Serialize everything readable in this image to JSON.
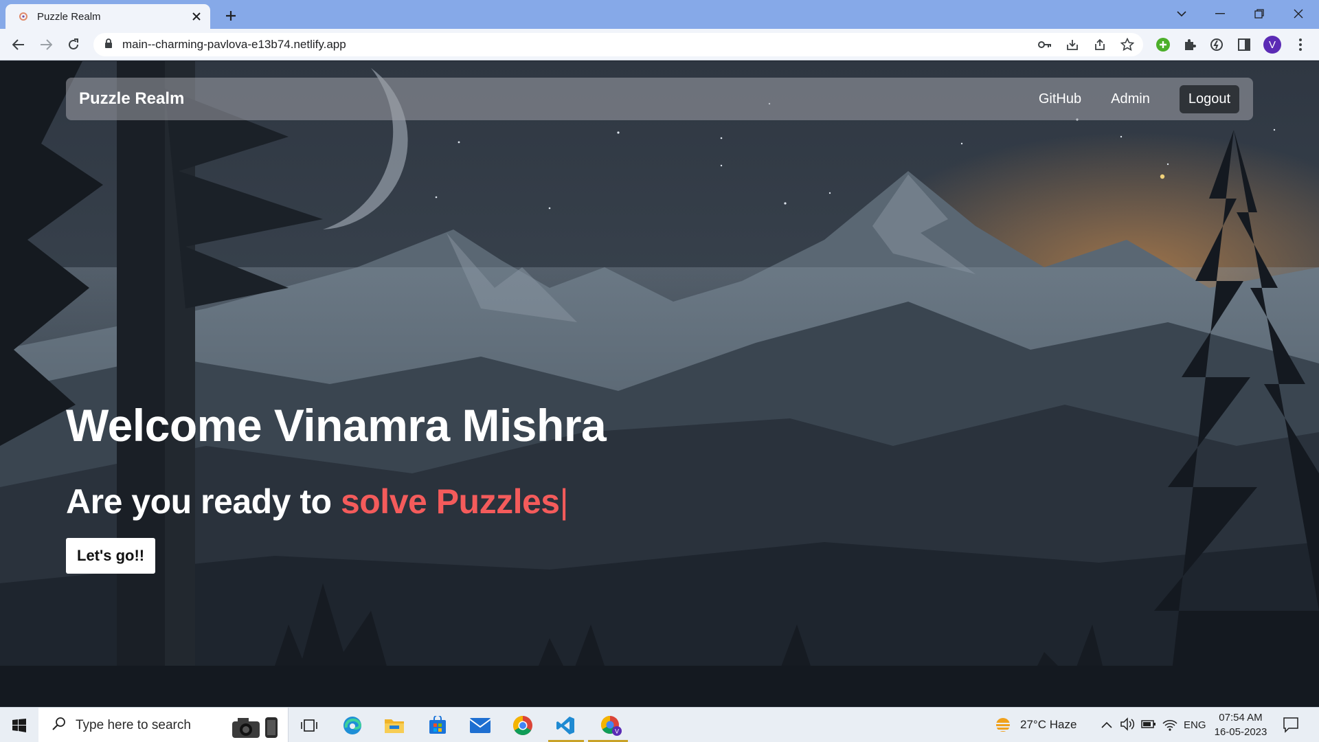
{
  "browser": {
    "tab_title": "Puzzle Realm",
    "url": "main--charming-pavlova-e13b74.netlify.app",
    "profile_initial": "V"
  },
  "site": {
    "brand": "Puzzle Realm",
    "nav": {
      "github": "GitHub",
      "admin": "Admin",
      "logout": "Logout"
    },
    "hero": {
      "welcome": "Welcome Vinamra Mishra",
      "prompt_prefix": "Are you ready to ",
      "prompt_highlight": "solve Puzzles",
      "caret": "|",
      "cta": "Let's go!!"
    },
    "colors": {
      "highlight": "#f45b5b",
      "navbar": "#a0a3aa"
    }
  },
  "taskbar": {
    "search_placeholder": "Type here to search",
    "weather": "27°C  Haze",
    "language": "ENG",
    "time": "07:54 AM",
    "date": "16-05-2023",
    "apps": [
      "camera-icon",
      "task-view-icon",
      "edge-icon",
      "file-explorer-icon",
      "store-icon",
      "mail-icon",
      "chrome-icon",
      "vscode-icon",
      "chrome-profile-icon"
    ]
  }
}
